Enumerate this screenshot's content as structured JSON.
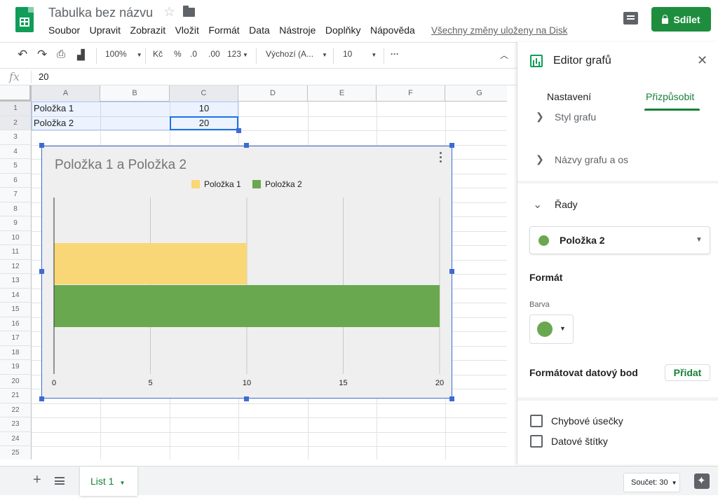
{
  "app": {
    "doc_title": "Tabulka bez názvu",
    "menu": [
      "Soubor",
      "Upravit",
      "Zobrazit",
      "Vložit",
      "Formát",
      "Data",
      "Nástroje",
      "Doplňky",
      "Nápověda"
    ],
    "saved_status": "Všechny změny uloženy na Disk",
    "share_label": "Sdílet"
  },
  "toolbar": {
    "zoom": "100%",
    "currency": "Kč",
    "percent": "%",
    "dec_less": ".0",
    "dec_more": ".00",
    "more_formats": "123",
    "font": "Výchozí (A...",
    "font_size": "10",
    "more": "···"
  },
  "formula_bar": {
    "fx": "fx",
    "value": "20"
  },
  "sheet": {
    "columns": [
      "A",
      "B",
      "C",
      "D",
      "E",
      "F",
      "G"
    ],
    "rows": [
      "1",
      "2",
      "3",
      "4",
      "5",
      "6",
      "7",
      "8",
      "9",
      "10",
      "11",
      "12",
      "13",
      "14",
      "15",
      "16",
      "17",
      "18",
      "19",
      "20",
      "21",
      "22",
      "23",
      "24",
      "25"
    ],
    "cells": {
      "A1": "Položka 1",
      "C1": "10",
      "A2": "Položka 2",
      "C2": "20"
    },
    "tab_label": "List 1",
    "sum_label": "Součet: 30"
  },
  "chart_data": {
    "type": "bar",
    "orientation": "horizontal",
    "title": "Položka 1 a Položka 2",
    "series": [
      {
        "name": "Položka 1",
        "values": [
          10
        ],
        "color": "#f9d776"
      },
      {
        "name": "Položka 2",
        "values": [
          20
        ],
        "color": "#6aa84f"
      }
    ],
    "xlim": [
      0,
      20
    ],
    "xticks": [
      "0",
      "5",
      "10",
      "15",
      "20"
    ],
    "grid": true,
    "legend_position": "top"
  },
  "panel": {
    "title": "Editor grafů",
    "tabs": [
      "Nastavení",
      "Přizpůsobit"
    ],
    "active_tab": "Přizpůsobit",
    "sections": {
      "chart_style": "Styl grafu",
      "titles": "Názvy grafu a os",
      "series": "Řady"
    },
    "series_selected": "Položka 2",
    "series_color": "#6aa84f",
    "format_label": "Formát",
    "color_label": "Barva",
    "format_point_label": "Formátovat datový bod",
    "add_label": "Přidat",
    "checkboxes": [
      "Chybové úsečky",
      "Datové štítky"
    ]
  }
}
